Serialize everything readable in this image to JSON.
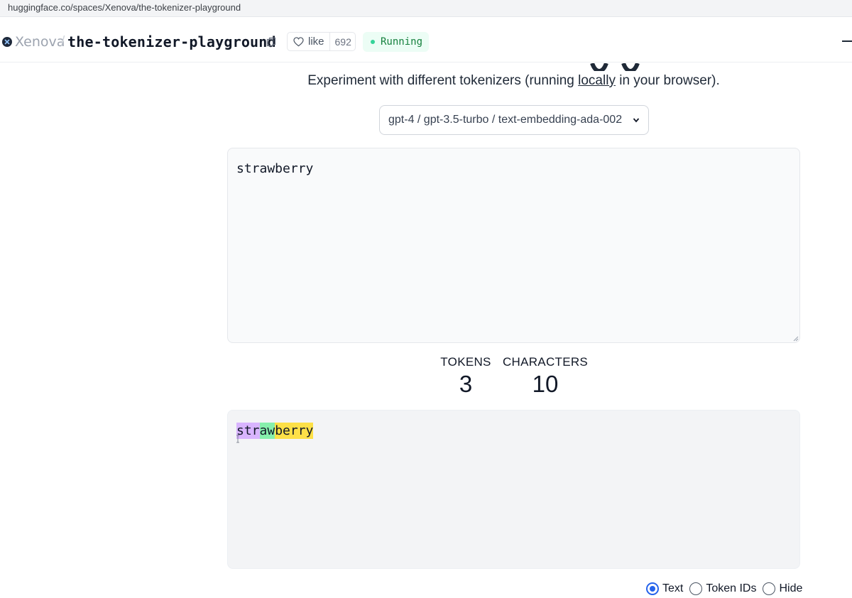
{
  "browser": {
    "url": "huggingface.co/spaces/Xenova/the-tokenizer-playground"
  },
  "header": {
    "owner": "Xenova",
    "separator": "/",
    "space_name": "the-tokenizer-playground",
    "like_label": "like",
    "like_count": "692",
    "status": "Running"
  },
  "main": {
    "subtitle_before": "Experiment with different tokenizers (running ",
    "subtitle_link": "locally",
    "subtitle_after": " in your browser).",
    "model_selected": "gpt-4 / gpt-3.5-turbo / text-embedding-ada-002",
    "input_text": "strawberry",
    "stats": {
      "tokens_label": "TOKENS",
      "tokens_value": "3",
      "characters_label": "CHARACTERS",
      "characters_value": "10"
    },
    "tokens": [
      {
        "text": "str",
        "color": "#d8b4fe"
      },
      {
        "text": "aw",
        "color": "#86efac"
      },
      {
        "text": "berry",
        "color": "#fde047"
      }
    ],
    "display_options": [
      {
        "label": "Text",
        "checked": true
      },
      {
        "label": "Token IDs",
        "checked": false
      },
      {
        "label": "Hide",
        "checked": false
      }
    ]
  },
  "colors": {
    "accent": "#2563eb",
    "status": "#15803d",
    "status_bg": "#ecfdf5"
  }
}
